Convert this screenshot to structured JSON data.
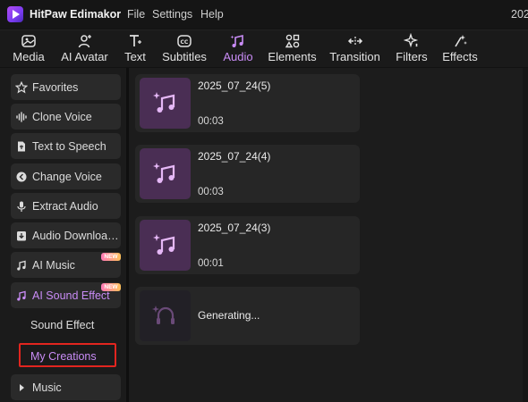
{
  "app": {
    "name": "HitPaw Edimakor",
    "menu": [
      "File",
      "Settings",
      "Help"
    ],
    "clipped_text": "202"
  },
  "toolbar": {
    "tabs": [
      {
        "label": "Media",
        "icon": "media-icon",
        "active": false
      },
      {
        "label": "AI Avatar",
        "icon": "ai-avatar-icon",
        "active": false
      },
      {
        "label": "Text",
        "icon": "text-icon",
        "active": false
      },
      {
        "label": "Subtitles",
        "icon": "subtitles-icon",
        "active": false
      },
      {
        "label": "Audio",
        "icon": "audio-icon",
        "active": true
      },
      {
        "label": "Elements",
        "icon": "elements-icon",
        "active": false
      },
      {
        "label": "Transition",
        "icon": "transition-icon",
        "active": false
      },
      {
        "label": "Filters",
        "icon": "filters-icon",
        "active": false
      },
      {
        "label": "Effects",
        "icon": "effects-icon",
        "active": false
      }
    ]
  },
  "sidebar": {
    "items": [
      {
        "label": "Favorites",
        "icon": "star-icon"
      },
      {
        "label": "Clone Voice",
        "icon": "waveform-icon"
      },
      {
        "label": "Text to Speech",
        "icon": "text-to-speech-icon"
      },
      {
        "label": "Change Voice",
        "icon": "change-voice-icon"
      },
      {
        "label": "Extract Audio",
        "icon": "microphone-icon"
      },
      {
        "label": "Audio Downloa…",
        "icon": "download-icon"
      },
      {
        "label": "AI Music",
        "icon": "ai-music-icon",
        "badge": "NEW"
      },
      {
        "label": "AI Sound Effect",
        "icon": "ai-sound-effect-icon",
        "badge": "NEW",
        "active": true
      }
    ],
    "subitems": [
      {
        "label": "Sound Effect",
        "active": false
      },
      {
        "label": "My Creations",
        "active": true
      }
    ],
    "music": {
      "label": "Music",
      "icon": "caret-right-icon"
    }
  },
  "creations": [
    {
      "title": "2025_07_24(5)",
      "duration": "00:03",
      "state": "done"
    },
    {
      "title": "2025_07_24(4)",
      "duration": "00:03",
      "state": "done"
    },
    {
      "title": "2025_07_24(3)",
      "duration": "00:01",
      "state": "done"
    },
    {
      "title": "Generating...",
      "duration": "",
      "state": "generating"
    }
  ],
  "colors": {
    "accent": "#c98cf6",
    "highlight": "#e2251f",
    "thumb": "#4a2e54"
  }
}
